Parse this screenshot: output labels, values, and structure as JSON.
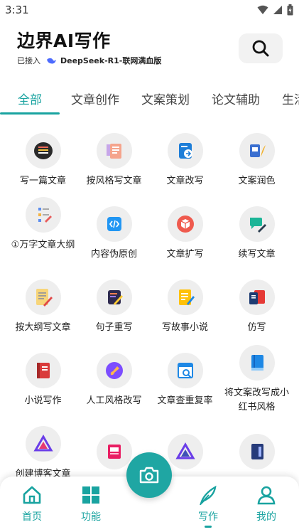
{
  "status": {
    "time": "3:31"
  },
  "header": {
    "title": "边界AI写作",
    "connected_prefix": "已接入",
    "model_label": "DeepSeek-R1-联网满血版"
  },
  "tabs": [
    "全部",
    "文章创作",
    "文案策划",
    "论文辅助",
    "生活"
  ],
  "tools": [
    {
      "label": "写一篇文章",
      "icon": "document-stack-icon"
    },
    {
      "label": "按风格写文章",
      "icon": "style-doc-icon"
    },
    {
      "label": "文章改写",
      "icon": "rewrite-icon"
    },
    {
      "label": "文案润色",
      "icon": "polish-icon"
    },
    {
      "label": "①万字文章大纲",
      "icon": "outline-icon"
    },
    {
      "label": "内容伪原创",
      "icon": "code-doc-icon"
    },
    {
      "label": "文章扩写",
      "icon": "expand-cube-icon"
    },
    {
      "label": "续写文章",
      "icon": "continue-write-icon"
    },
    {
      "label": "按大纲写文章",
      "icon": "outline-write-icon"
    },
    {
      "label": "句子重写",
      "icon": "sentence-rewrite-icon"
    },
    {
      "label": "写故事小说",
      "icon": "story-icon"
    },
    {
      "label": "仿写",
      "icon": "imitate-icon"
    },
    {
      "label": "小说写作",
      "icon": "novel-book-icon"
    },
    {
      "label": "人工风格改写",
      "icon": "brush-style-icon"
    },
    {
      "label": "文章查重复率",
      "icon": "plagiarism-check-icon"
    },
    {
      "label": "将文案改写成小红书风格",
      "icon": "blue-book-icon"
    },
    {
      "label": "创建博客文章",
      "icon": "blog-logo-icon"
    },
    {
      "label": "",
      "icon": "magazine-icon"
    },
    {
      "label": "",
      "icon": "logo-triangle-icon"
    },
    {
      "label": "",
      "icon": "notebook-icon"
    }
  ],
  "bottom_nav": {
    "home": "首页",
    "features": "功能",
    "write": "写作",
    "mine": "我的"
  },
  "colors": {
    "accent": "#19a3a0",
    "icon_bg": "#eeeeee"
  }
}
